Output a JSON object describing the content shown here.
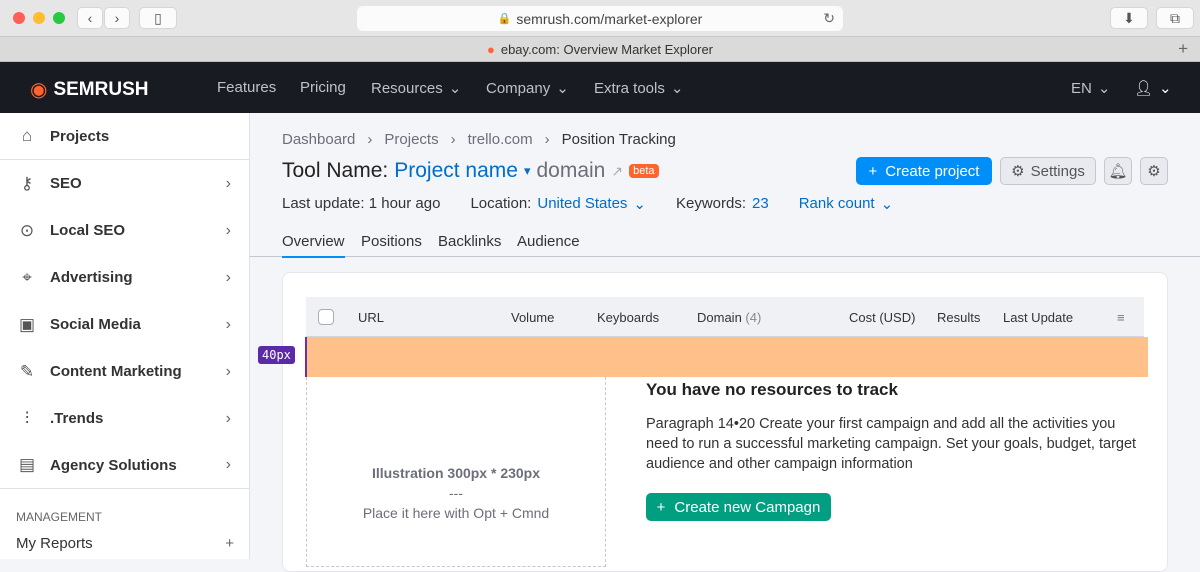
{
  "browser": {
    "url": "semrush.com/market-explorer",
    "tab_title": "ebay.com: Overview Market Explorer"
  },
  "nav": {
    "logo": "SEMRUSH",
    "items": [
      "Features",
      "Pricing",
      "Resources",
      "Company",
      "Extra tools"
    ],
    "lang": "EN"
  },
  "sidebar": {
    "items": [
      {
        "label": "Projects"
      },
      {
        "label": "SEO"
      },
      {
        "label": "Local SEO"
      },
      {
        "label": "Advertising"
      },
      {
        "label": "Social Media"
      },
      {
        "label": "Content Marketing"
      },
      {
        "label": ".Trends"
      },
      {
        "label": "Agency Solutions"
      }
    ],
    "section": "MANAGEMENT",
    "my_reports": "My Reports"
  },
  "breadcrumb": [
    "Dashboard",
    "Projects",
    "trello.com",
    "Position Tracking"
  ],
  "header": {
    "tool": "Tool Name:",
    "project": "Project name",
    "domain": "domain",
    "badge": "beta",
    "create": "Create project",
    "settings": "Settings"
  },
  "meta": {
    "last_update": "Last update: 1 hour ago",
    "location_label": "Location:",
    "location": "United States",
    "keywords_label": "Keywords:",
    "keywords": "23",
    "rank": "Rank count"
  },
  "tabs": [
    "Overview",
    "Positions",
    "Backlinks",
    "Audience"
  ],
  "table": {
    "columns": [
      "URL",
      "Volume",
      "Keyboards",
      "Domain",
      "Cost (USD)",
      "Results",
      "Last Update"
    ],
    "domain_count": "(4)"
  },
  "spacer_label": "40px",
  "empty": {
    "illustration": "Illustration 300px * 230px",
    "sep": "---",
    "hint": "Place it here with Opt + Cmnd",
    "title": "You have no resources to track",
    "text": "Paragraph 14•20 Create your first campaign and add all the activities you need to run a successful marketing campaign. Set your goals, budget, target audience and other campaign information",
    "button": "Create new Campagn"
  },
  "colors": {
    "accent": "#008ff8",
    "green": "#009f81",
    "orange": "#ffc08a",
    "nav": "#191b23"
  }
}
